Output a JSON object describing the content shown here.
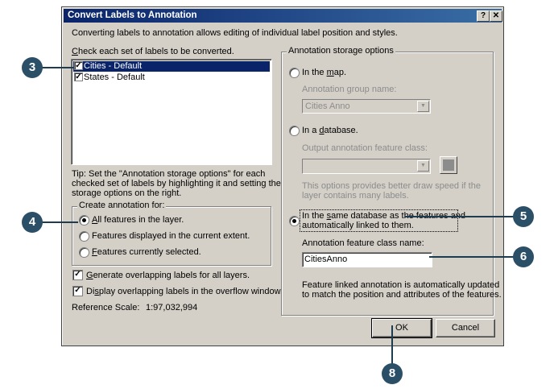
{
  "dialog": {
    "title": "Convert Labels to Annotation",
    "help_btn": "?",
    "close_btn": "✕",
    "intro": "Converting labels to annotation allows editing of individual label position and styles.",
    "check_label": "Check each set of labels to be converted.",
    "label_sets": [
      {
        "label": "Cities - Default",
        "checked": true,
        "selected": true
      },
      {
        "label": "States - Default",
        "checked": true,
        "selected": false
      }
    ],
    "tip": [
      "Tip:  Set the \"Annotation storage options\" for each",
      "checked set of labels by highlighting it and setting the",
      "storage options on the right."
    ],
    "create_group": {
      "title": "Create annotation for:",
      "options": [
        "All features in the layer.",
        "Features displayed in the current extent.",
        "Features currently selected."
      ],
      "selected_index": 0
    },
    "generate_overlap": "Generate overlapping labels for all layers.",
    "display_overlap": "Display overlapping labels in the overflow window.",
    "reference_scale_label": "Reference Scale:",
    "reference_scale_value": "1:97,032,994",
    "storage": {
      "title": "Annotation storage options",
      "in_map": "In the map.",
      "group_name_label": "Annotation group name:",
      "group_name_value": "Cities Anno",
      "in_database": "In a database.",
      "output_class_label": "Output annotation feature class:",
      "db_note": [
        "This options provides better draw speed if the",
        "layer contains many labels."
      ],
      "same_db": [
        "In the same database as the features and",
        "automatically linked to them."
      ],
      "class_name_label": "Annotation feature class name:",
      "class_name_value": "CitiesAnno",
      "linked_note": [
        "Feature linked annotation is automatically updated",
        "to match the position and attributes of the features."
      ]
    },
    "ok": "OK",
    "cancel": "Cancel"
  },
  "callouts": {
    "c3": "3",
    "c4": "4",
    "c5": "5",
    "c6": "6",
    "c8": "8"
  },
  "colors": {
    "title_start": "#0a246a",
    "callout": "#2b4f67",
    "selection": "#0a246a"
  }
}
